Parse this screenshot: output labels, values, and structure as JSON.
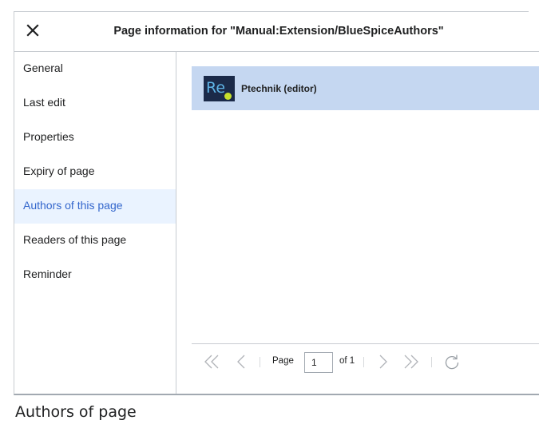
{
  "dialog": {
    "title": "Page information for \"Manual:Extension/BlueSpiceAuthors\"",
    "close_icon": "close-icon"
  },
  "sidebar": {
    "items": [
      {
        "label": "General",
        "active": false
      },
      {
        "label": "Last edit",
        "active": false
      },
      {
        "label": "Properties",
        "active": false
      },
      {
        "label": "Expiry of page",
        "active": false
      },
      {
        "label": "Authors of this page",
        "active": true
      },
      {
        "label": "Readers of this page",
        "active": false
      },
      {
        "label": "Reminder",
        "active": false
      }
    ]
  },
  "authors": [
    {
      "avatar_text": "Re",
      "name": "Ptechnik (editor)"
    }
  ],
  "pager": {
    "page_label": "Page",
    "current_page": "1",
    "of_label": "of 1",
    "icons": [
      "first-page-icon",
      "prev-page-icon",
      "next-page-icon",
      "last-page-icon",
      "refresh-icon"
    ]
  },
  "caption": "Authors of page",
  "colors": {
    "accent": "#3366cc",
    "active_bg": "#eaf3ff",
    "selected_row_bg": "#c5d7f1",
    "border": "#c8ccd1"
  }
}
